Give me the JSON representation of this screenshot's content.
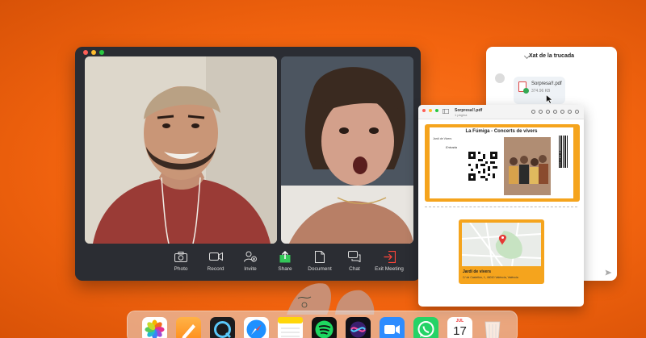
{
  "meeting": {
    "toolbar": [
      {
        "label": "Photo",
        "icon": "camera-icon"
      },
      {
        "label": "Record",
        "icon": "video-camera-icon"
      },
      {
        "label": "Invite",
        "icon": "add-person-icon"
      },
      {
        "label": "Share",
        "icon": "share-icon"
      },
      {
        "label": "Document",
        "icon": "document-icon"
      },
      {
        "label": "Chat",
        "icon": "chat-bubbles-icon"
      },
      {
        "label": "Exit Meeting",
        "icon": "exit-icon"
      }
    ],
    "colors": {
      "share_accent": "#34c759",
      "exit_accent": "#ff453a"
    }
  },
  "chat": {
    "title": "Xat de la trucada",
    "attachment": {
      "name": "Sorpresa!!.pdf",
      "size": "374.96 KB"
    }
  },
  "pdf_viewer": {
    "title": "Sorpresa!!.pdf",
    "subtitle": "1 pàgina",
    "ticket": {
      "title": "La Fúmiga - Concerts de vivers",
      "venue": "Jardí de Vivers",
      "entry_label": "Entrada",
      "stub_label": "ENTRADA"
    },
    "map_card": {
      "name": "Jardí de vivers",
      "address": "C/ de Castellón, 1, 46010 València, València"
    }
  },
  "dock": {
    "apps": [
      {
        "name": "Photos",
        "icon": "photos-icon"
      },
      {
        "name": "Pages",
        "icon": "pages-icon"
      },
      {
        "name": "QuickTime",
        "icon": "quicktime-icon"
      },
      {
        "name": "Safari",
        "icon": "safari-icon"
      },
      {
        "name": "Notes",
        "icon": "notes-icon"
      },
      {
        "name": "Spotify",
        "icon": "spotify-icon"
      },
      {
        "name": "Siri",
        "icon": "siri-icon"
      },
      {
        "name": "Zoom",
        "icon": "zoom-icon"
      },
      {
        "name": "WhatsApp",
        "icon": "whatsapp-icon"
      },
      {
        "name": "Calendar",
        "icon": "calendar-icon"
      },
      {
        "name": "Trash",
        "icon": "trash-icon"
      }
    ],
    "calendar": {
      "month": "JUL",
      "day": "17"
    }
  },
  "colors": {
    "background": "#f3640f",
    "ticket_orange": "#f5a41d"
  }
}
